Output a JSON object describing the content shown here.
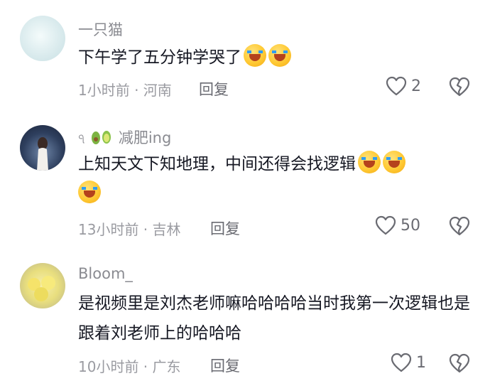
{
  "comments": [
    {
      "username": "一只猫",
      "text": "下午学了五分钟学哭了",
      "time_location": "1小时前 · 河南",
      "reply_label": "回复",
      "like_count": "2",
      "emoji": [
        "loudly-crying-face",
        "loudly-crying-face"
      ]
    },
    {
      "username_prefix": "ঀ",
      "username": "减肥ing",
      "text": "上知天文下知地理，中间还得会找逻辑",
      "time_location": "13小时前 · 吉林",
      "reply_label": "回复",
      "like_count": "50",
      "emoji": [
        "tears-of-joy-face",
        "tears-of-joy-face",
        "tears-of-joy-face"
      ]
    },
    {
      "username": "Bloom_",
      "text": "是视频里是刘杰老师嘛哈哈哈哈当时我第一次逻辑也是跟着刘老师上的哈哈哈",
      "time_location": "10小时前 · 广东",
      "reply_label": "回复",
      "like_count": "1"
    }
  ],
  "icons": {
    "like": "heart-outline-icon",
    "dislike": "broken-heart-icon"
  },
  "colors": {
    "text": "#161823",
    "secondary": "#8a8b91",
    "background": "#ffffff"
  }
}
